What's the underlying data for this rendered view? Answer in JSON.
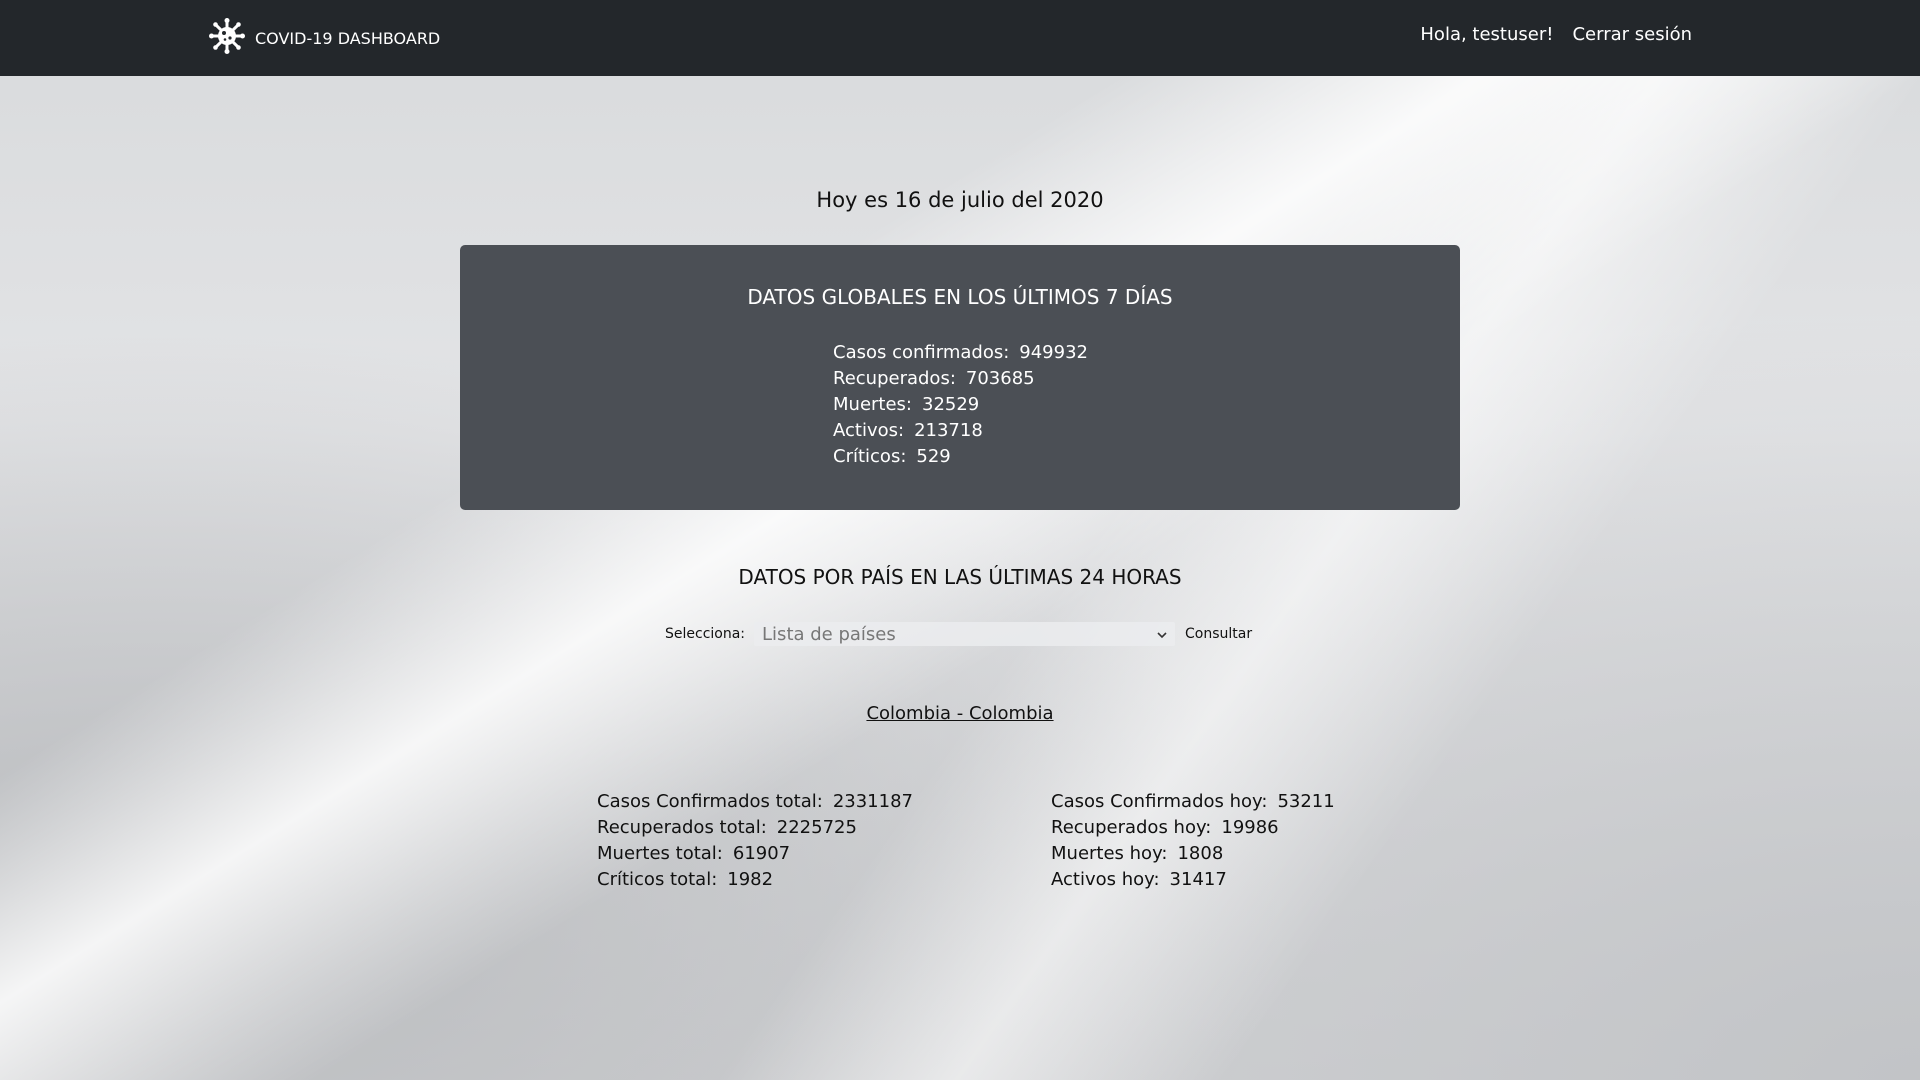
{
  "navbar": {
    "brand": "COVID-19 DASHBOARD",
    "brand_icon": "virus-icon",
    "greeting": "Hola, testuser!",
    "logout": "Cerrar sesión"
  },
  "date_line": "Hoy es 16 de julio del 2020",
  "global": {
    "title": "DATOS GLOBALES EN LOS ÚLTIMOS 7 DÍAS",
    "rows": [
      {
        "label": "Casos confirmados:",
        "value": "949932"
      },
      {
        "label": "Recuperados:",
        "value": "703685"
      },
      {
        "label": "Muertes:",
        "value": "32529"
      },
      {
        "label": "Activos:",
        "value": "213718"
      },
      {
        "label": "Críticos:",
        "value": "529"
      }
    ]
  },
  "country_section": {
    "title": "DATOS POR PAÍS EN LAS ÚLTIMAS 24 HORAS",
    "select_label": "Selecciona:",
    "select_placeholder": "Lista de países",
    "consult_label": "Consultar",
    "country_name": "Colombia - Colombia",
    "totals": [
      {
        "label": "Casos Confirmados total:",
        "value": "2331187"
      },
      {
        "label": "Recuperados total:",
        "value": "2225725"
      },
      {
        "label": "Muertes total:",
        "value": "61907"
      },
      {
        "label": "Críticos total:",
        "value": "1982"
      }
    ],
    "today": [
      {
        "label": "Casos Confirmados hoy:",
        "value": "53211"
      },
      {
        "label": "Recuperados hoy:",
        "value": "19986"
      },
      {
        "label": "Muertes hoy:",
        "value": "1808"
      },
      {
        "label": "Activos hoy:",
        "value": "31417"
      }
    ]
  },
  "colors": {
    "navbar_bg": "#23272b",
    "card_bg": "#4b4f55"
  }
}
